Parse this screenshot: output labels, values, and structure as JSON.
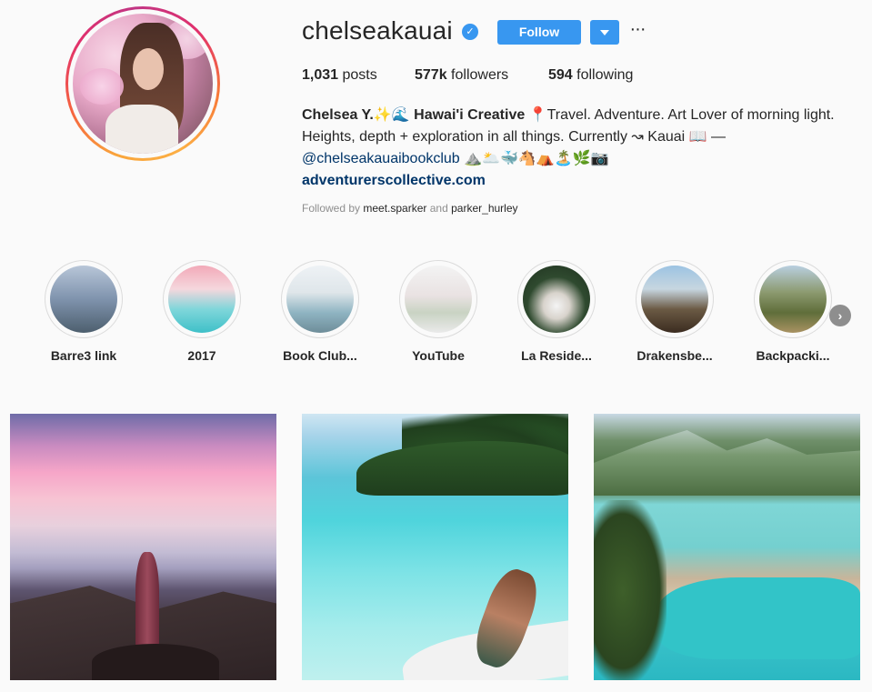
{
  "profile": {
    "username": "chelseakauai",
    "follow_label": "Follow",
    "more_label": "···",
    "stats": {
      "posts_count": "1,031",
      "posts_label": "posts",
      "followers_count": "577k",
      "followers_label": "followers",
      "following_count": "594",
      "following_label": "following"
    },
    "bio": {
      "name": "Chelsea Y.✨🌊 Hawai'i Creative",
      "line1_rest": " 📍Travel. Adventure. Art Lover of morning light.",
      "line2": "Heights, depth + exploration in all things. Currently ↝ Kauai 📖 —",
      "mention": "@chelseakauaibookclub",
      "emoji_row": " ⛰️🌥️🐳🐴⛺🏝️🌿📷",
      "link": "adventurerscollective.com"
    },
    "followed_by": {
      "prefix": "Followed by",
      "user1": "meet.sparker",
      "conj": "and",
      "user2": "parker_hurley"
    }
  },
  "highlights": [
    {
      "label": "Barre3 link"
    },
    {
      "label": "2017"
    },
    {
      "label": "Book Club..."
    },
    {
      "label": "YouTube"
    },
    {
      "label": "La Reside..."
    },
    {
      "label": "Drakensbe..."
    },
    {
      "label": "Backpacki..."
    }
  ],
  "colors": {
    "accent": "#3897f0",
    "link": "#003569",
    "muted": "#8e8e8e",
    "text": "#262626",
    "background": "#fafafa"
  },
  "icons": {
    "verified": "verified-badge-icon",
    "dropdown": "chevron-down-icon",
    "more": "more-options-icon",
    "next": "chevron-right-icon"
  }
}
